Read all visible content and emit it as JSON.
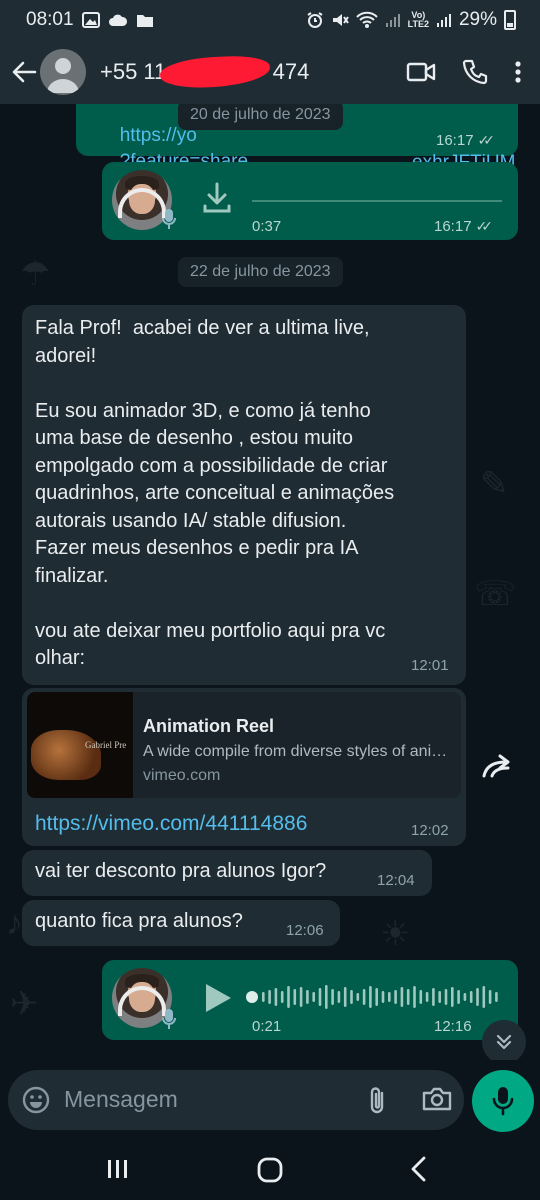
{
  "status_bar": {
    "time": "08:01",
    "network_label": "Vo)\nLTE2",
    "battery": "29%"
  },
  "header": {
    "contact_name": "+55 11 9",
    "contact_suffix": "474"
  },
  "messages": {
    "partial_link_top": "https://yo",
    "partial_link_top_right": "exhrJFTjUM",
    "partial_link_param": "?feature=share",
    "partial_time": "16:17",
    "date_chip_1": "20 de julho de 2023",
    "voice_1": {
      "duration": "0:37",
      "time": "16:17"
    },
    "date_chip_2": "22 de julho de 2023",
    "long_msg": {
      "text": "Fala Prof!  acabei de ver a ultima live,\nadorei!\n\nEu sou animador 3D, e como já tenho\numa base de desenho , estou muito\nempolgado com a possibilidade de criar\nquadrinhos, arte conceitual e animações\nautorais usando IA/ stable difusion.\nFazer meus desenhos e pedir pra IA\nfinalizar.\n\nvou ate deixar meu portfolio aqui pra vc\nolhar:",
      "time": "12:01"
    },
    "link_msg": {
      "preview_title": "Animation Reel",
      "preview_desc": "A wide compile from diverse styles of animation...",
      "preview_domain": "vimeo.com",
      "thumb_text": "Gabriel Pre",
      "url": "https://vimeo.com/441114886",
      "time": "12:02"
    },
    "msg_discount": {
      "text": "vai ter desconto pra alunos Igor?",
      "time": "12:04"
    },
    "msg_price": {
      "text": "quanto fica pra alunos?",
      "time": "12:06"
    },
    "voice_2": {
      "duration": "0:21",
      "time": "12:16"
    }
  },
  "input": {
    "placeholder": "Mensagem"
  },
  "colors": {
    "outgoing_bubble": "#005c4b",
    "incoming_bubble": "#202c33",
    "accent": "#00a884",
    "link": "#53bdeb",
    "redaction": "#ff1a33"
  }
}
